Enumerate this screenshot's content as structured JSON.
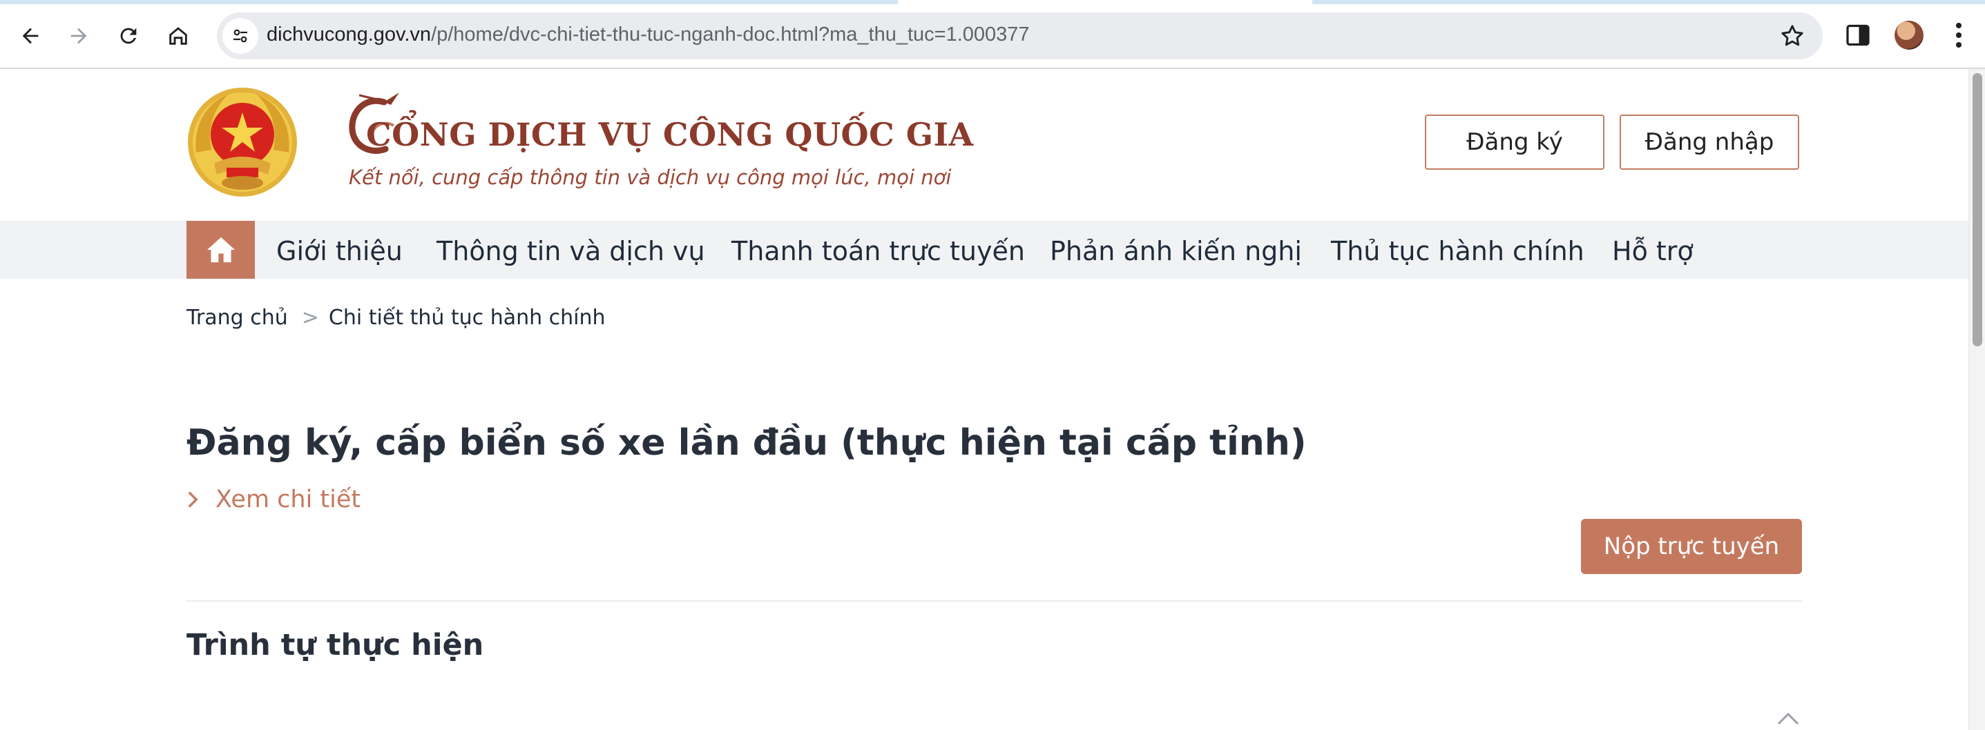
{
  "browser": {
    "url_host": "dichvucong.gov.vn",
    "url_path": "/p/home/dvc-chi-tiet-thu-tuc-nganh-doc.html?ma_thu_tuc=1.000377"
  },
  "header": {
    "brand_title": "CỔNG DỊCH VỤ CÔNG QUỐC GIA",
    "brand_tagline": "Kết nối, cung cấp thông tin và dịch vụ công mọi lúc, mọi nơi",
    "register_label": "Đăng ký",
    "login_label": "Đăng nhập"
  },
  "nav": {
    "items": [
      {
        "label": "Giới thiệu"
      },
      {
        "label": "Thông tin và dịch vụ"
      },
      {
        "label": "Thanh toán trực tuyến"
      },
      {
        "label": "Phản ánh kiến nghị"
      },
      {
        "label": "Thủ tục hành chính"
      },
      {
        "label": "Hỗ trợ"
      }
    ]
  },
  "breadcrumb": {
    "home": "Trang chủ",
    "separator": ">",
    "current": "Chi tiết thủ tục hành chính"
  },
  "procedure": {
    "title": "Đăng ký, cấp biển số xe lần đầu (thực hiện tại cấp tỉnh)",
    "detail_link": "Xem chi tiết",
    "submit_label": "Nộp trực tuyến",
    "section_title": "Trình tự thực hiện"
  },
  "colors": {
    "accent": "#c4795f",
    "brand": "#8b3a2b",
    "nav_bg": "#f1f2f4"
  },
  "icons": {
    "back": "arrow-left-icon",
    "forward": "arrow-right-icon",
    "reload": "reload-icon",
    "home": "home-icon",
    "site_info": "tune-icon",
    "bookmark": "star-icon",
    "side_panel": "side-panel-icon",
    "menu": "more-vert-icon",
    "nav_home": "home-icon",
    "expand": "chevron-up-icon"
  }
}
